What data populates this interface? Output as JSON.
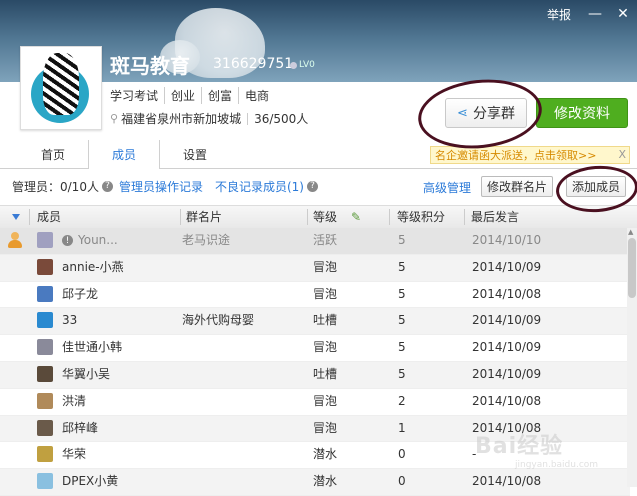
{
  "header": {
    "group_name": "斑马教育",
    "group_id": "316629751",
    "level": "LV0",
    "report": "举报",
    "minimize_icon": "minimize-icon",
    "close_icon": "close-icon"
  },
  "info": {
    "tags": [
      "学习考试",
      "创业",
      "创富",
      "电商"
    ],
    "location": "福建省泉州市新加坡城",
    "member_count": "36/500人"
  },
  "actions": {
    "share": "分享群",
    "edit": "修改资料"
  },
  "tabs": [
    {
      "label": "首页"
    },
    {
      "label": "成员"
    },
    {
      "label": "设置"
    }
  ],
  "active_tab": "成员",
  "promo": {
    "text": "名企邀请函大派送，点击领取>>",
    "close": "X"
  },
  "toolbar": {
    "admin_count": "管理员：0/10人",
    "admin_log": "管理员操作记录",
    "bad_record": "不良记录成员(1)",
    "advanced": "高级管理",
    "edit_card": "修改群名片",
    "add_member": "添加成员"
  },
  "table": {
    "headers": [
      "成员",
      "群名片",
      "等级",
      "等级积分",
      "最后发言"
    ],
    "rows": [
      {
        "name": "Youn...",
        "card": "老马识途",
        "level": "活跃",
        "points": "5",
        "last": "2014/10/10",
        "owner": true,
        "muted": true
      },
      {
        "name": "annie-小燕",
        "card": "",
        "level": "冒泡",
        "points": "5",
        "last": "2014/10/09"
      },
      {
        "name": "邱子龙",
        "card": "",
        "level": "冒泡",
        "points": "5",
        "last": "2014/10/08"
      },
      {
        "name": "33",
        "card": "海外代购母婴",
        "level": "吐槽",
        "points": "5",
        "last": "2014/10/09"
      },
      {
        "name": "佳世通小韩",
        "card": "",
        "level": "冒泡",
        "points": "5",
        "last": "2014/10/09"
      },
      {
        "name": "华翼小吴",
        "card": "",
        "level": "吐槽",
        "points": "5",
        "last": "2014/10/09"
      },
      {
        "name": "洪清",
        "card": "",
        "level": "冒泡",
        "points": "2",
        "last": "2014/10/08"
      },
      {
        "name": "邱梓峰",
        "card": "",
        "level": "冒泡",
        "points": "1",
        "last": "2014/10/08"
      },
      {
        "name": "华荣",
        "card": "",
        "level": "潜水",
        "points": "0",
        "last": "-"
      },
      {
        "name": "DPEX小黄",
        "card": "",
        "level": "潜水",
        "points": "0",
        "last": "2014/10/08"
      }
    ]
  },
  "avatar_colors": [
    "#a0a0c0",
    "#7a4a3a",
    "#4a7ac0",
    "#2a8ad0",
    "#8a8a9a",
    "#5a4a3a",
    "#b08a5a",
    "#6a5a4a",
    "#c0a040",
    "#8ac0e0"
  ],
  "watermark": {
    "brand": "Bai",
    "suffix": "经验",
    "url": "jingyan.baidu.com"
  }
}
